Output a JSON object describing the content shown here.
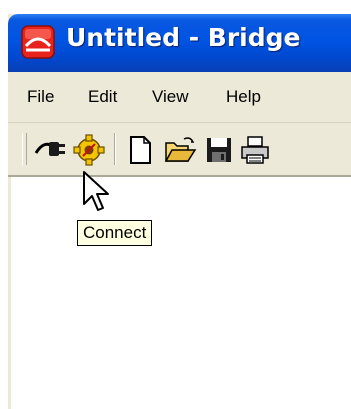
{
  "window": {
    "title": "Untitled - Bridge"
  },
  "menu": {
    "items": [
      {
        "label": "File"
      },
      {
        "label": "Edit"
      },
      {
        "label": "View"
      },
      {
        "label": "Help"
      }
    ]
  },
  "toolbar": {
    "buttons": [
      {
        "icon": "plug-icon"
      },
      {
        "icon": "gear-icon"
      },
      {
        "icon": "new-document-icon"
      },
      {
        "icon": "open-folder-icon"
      },
      {
        "icon": "save-disk-icon"
      },
      {
        "icon": "printer-icon"
      }
    ]
  },
  "tooltip": {
    "text": "Connect"
  }
}
